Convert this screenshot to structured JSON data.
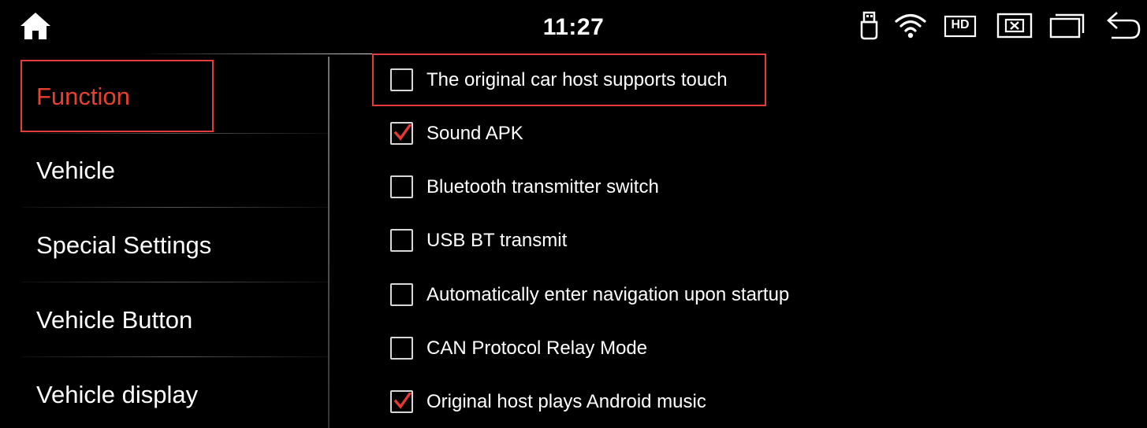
{
  "status_bar": {
    "time": "11:27",
    "icons": [
      "home-icon",
      "usb-icon",
      "wifi-icon",
      "hd-icon",
      "close-window-icon",
      "multi-window-icon",
      "back-icon"
    ],
    "hd_text": "HD"
  },
  "sidebar": {
    "items": [
      {
        "label": "Function",
        "active": true
      },
      {
        "label": "Vehicle",
        "active": false
      },
      {
        "label": "Special Settings",
        "active": false
      },
      {
        "label": "Vehicle Button",
        "active": false
      },
      {
        "label": "Vehicle display",
        "active": false
      }
    ]
  },
  "options": [
    {
      "label": "The original car host supports touch",
      "checked": false,
      "highlighted": true
    },
    {
      "label": "Sound APK",
      "checked": true,
      "highlighted": false
    },
    {
      "label": "Bluetooth transmitter switch",
      "checked": false,
      "highlighted": false
    },
    {
      "label": "USB BT transmit",
      "checked": false,
      "highlighted": false
    },
    {
      "label": "Automatically enter navigation upon startup",
      "checked": false,
      "highlighted": false
    },
    {
      "label": "CAN Protocol Relay Mode",
      "checked": false,
      "highlighted": false
    },
    {
      "label": "Original host plays Android music",
      "checked": true,
      "highlighted": false
    }
  ],
  "colors": {
    "background": "#000000",
    "active_text": "#e8402e",
    "highlight_frame": "#e23c3c",
    "checkmark": "#e53935"
  }
}
